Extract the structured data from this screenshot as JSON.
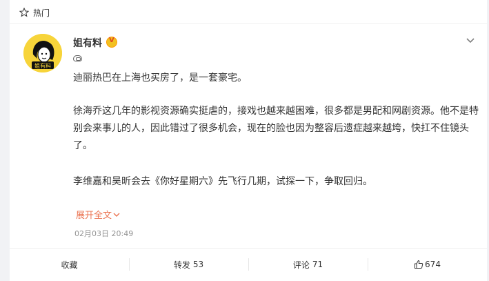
{
  "header": {
    "label": "热门",
    "icon": "star-outline-icon"
  },
  "post": {
    "author": "姐有料",
    "avatar_text": "姐有料",
    "verified_icon": "verified-v-badge-icon",
    "source_icon": "weibo-source-icon",
    "menu_icon": "chevron-down-icon",
    "paragraphs": [
      "迪丽热巴在上海也买房了，是一套豪宅。",
      "徐海乔这几年的影视资源确实挺虐的，接戏也越来越困难，很多都是男配和网剧资源。他不是特别会来事儿的人，因此错过了很多机会，现在的脸也因为整容后遗症越来越垮，快扛不住镜头了。",
      "李维嘉和吴昕会去《你好星期六》先飞行几期，试探一下，争取回归。"
    ],
    "expand_label": "展开全文",
    "timestamp": "02月03日 20:49"
  },
  "actions": {
    "favorite_label": "收藏",
    "repost_label": "转发",
    "repost_count": "53",
    "comment_label": "评论",
    "comment_count": "71",
    "like_count": "674",
    "like_icon": "thumbs-up-icon"
  },
  "colors": {
    "accent": "#eb7350",
    "timestamp": "#939393",
    "background": "#f1f2f5"
  }
}
